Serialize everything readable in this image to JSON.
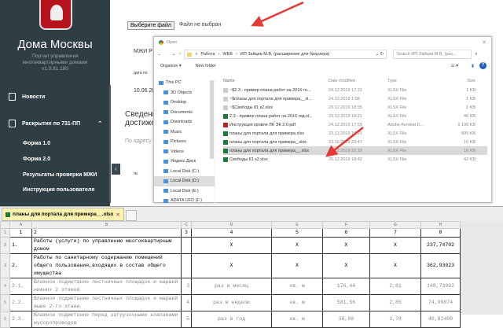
{
  "sidebar": {
    "brand": "Дома Москвы",
    "subtitle1": "Портал управления",
    "subtitle2": "многоквартирными домами",
    "version": "v1.0.81.180",
    "items": [
      {
        "label": "Новости"
      },
      {
        "label": "Раскрытие по 731-ПП"
      }
    ],
    "subitems": [
      {
        "label": "Форма 1.0"
      },
      {
        "label": "Форма 2.0"
      },
      {
        "label": "Результаты проверки МЖИ"
      },
      {
        "label": "Инструкция пользователя"
      }
    ]
  },
  "main": {
    "choose_file": "Выберите файл",
    "no_file": "Файл не выбран",
    "mzhi": "МЖИ Р",
    "date_label": "дата по",
    "date": "10.06.20",
    "heading1": "Сведени",
    "heading2": "достиже",
    "by_address": "По адресу",
    "num": "№"
  },
  "dialog": {
    "title": "Open",
    "path": [
      "«",
      "Работа",
      "›",
      "WEB",
      "›",
      "ИП Зайцев М.В. (расширение для браузера)"
    ],
    "search_placeholder": "Search ИП Зайцев М.В. (рас...",
    "organize": "Organize ▾",
    "new_folder": "New folder",
    "tree": [
      "This PC",
      "3D Objects",
      "Desktop",
      "Documents",
      "Downloads",
      "Music",
      "Pictures",
      "Videos",
      "Яндекс.Диск",
      "Local Disk (C:)",
      "Local Disk (D:)",
      "Local Disk (E:)",
      "ADATA UFD (F:)"
    ],
    "columns": [
      "Name",
      "Date modified",
      "Type",
      "Size"
    ],
    "files": [
      {
        "name": "~$2.3 - пример плана работ на 2016 го...",
        "date": "24.12.2019 17:31",
        "type": "XLSX File",
        "size": "1 KB",
        "kind": "tmp"
      },
      {
        "name": "~$планы для портала для примера__xl...",
        "date": "24.12.2019 1:08",
        "type": "XLSX File",
        "size": "1 KB",
        "kind": "tmp"
      },
      {
        "name": "~$Свободы 81 к2.xlsx",
        "date": "23.12.2019 18:55",
        "type": "XLSX File",
        "size": "1 KB",
        "kind": "tmp"
      },
      {
        "name": "2.3 - пример плана работ на 2016 год.xl...",
        "date": "23.12.2019 18:21",
        "type": "XLSX File",
        "size": "46 KB",
        "kind": "xlsx"
      },
      {
        "name": "Инструкция кровля ЛК ЭК 2.0.pdf",
        "date": "24.12.2019 17:59",
        "type": "Adobe Acrobat D...",
        "size": "1 198 KB",
        "kind": "pdf"
      },
      {
        "name": "планы для портала для примера.xlsx",
        "date": "23.12.2019 19:21",
        "type": "XLSX File",
        "size": "895 KB",
        "kind": "xlsx"
      },
      {
        "name": "планы для портала для примера_.xlsx",
        "date": "23.12.2019 23:47",
        "type": "XLSX File",
        "size": "16 KB",
        "kind": "xlsx"
      },
      {
        "name": "планы для портала для примера__.xlsx",
        "date": "24.12.2019 22:18",
        "type": "XLSX File",
        "size": "16 KB",
        "kind": "xlsx",
        "selected": true
      },
      {
        "name": "Свободы 81 к2.xlsx",
        "date": "25.12.2019 18:42",
        "type": "XLSX File",
        "size": "42 KB",
        "kind": "xlsx"
      }
    ]
  },
  "sheet": {
    "tab": "планы для портала для примера__.xlsx",
    "col_headers": [
      "A",
      "B",
      "C",
      "D",
      "E",
      "F",
      "G",
      "H"
    ],
    "rows": [
      {
        "n": "1",
        "cells": [
          "1",
          "2",
          "3",
          "4",
          "5",
          "6",
          "7",
          "8"
        ]
      },
      {
        "n": "2",
        "cells": [
          "1.",
          "Работы (услуги) по управлению многоквартирным домом",
          "",
          "X",
          "X",
          "X",
          "X",
          "237,74702"
        ]
      },
      {
        "n": "3",
        "cells": [
          "2.",
          "Работы по санитарному содержанию помещений общего пользования,входящих в состав общего имущества",
          "",
          "X",
          "X",
          "X",
          "X",
          "362,93023"
        ]
      },
      {
        "n": "4",
        "cells": [
          "2.1.",
          "Влажное подметание лестничных площадок и маршей нижних 2 этажей",
          "3",
          "раз в месяц",
          "кв. м",
          "176,44",
          "2,81",
          "148,73892"
        ]
      },
      {
        "n": "5",
        "cells": [
          "2.2.",
          "Влажное подметание лестничных площадок и маршей выше 2-го этажа",
          "4",
          "раз в неделю",
          "кв. м",
          "581,56",
          "2,85",
          "74,09074"
        ]
      },
      {
        "n": "6",
        "cells": [
          "2.3.",
          "Влажное подметание перед загрузочными клапанами мусоропроводов",
          "5",
          "раз в год",
          "кв. м",
          "36,00",
          "3,78",
          "40,82400"
        ]
      }
    ]
  },
  "colors": {
    "sidebar": "#2f3d45",
    "arrow": "#e53935",
    "selected": "#d9d9d9"
  }
}
